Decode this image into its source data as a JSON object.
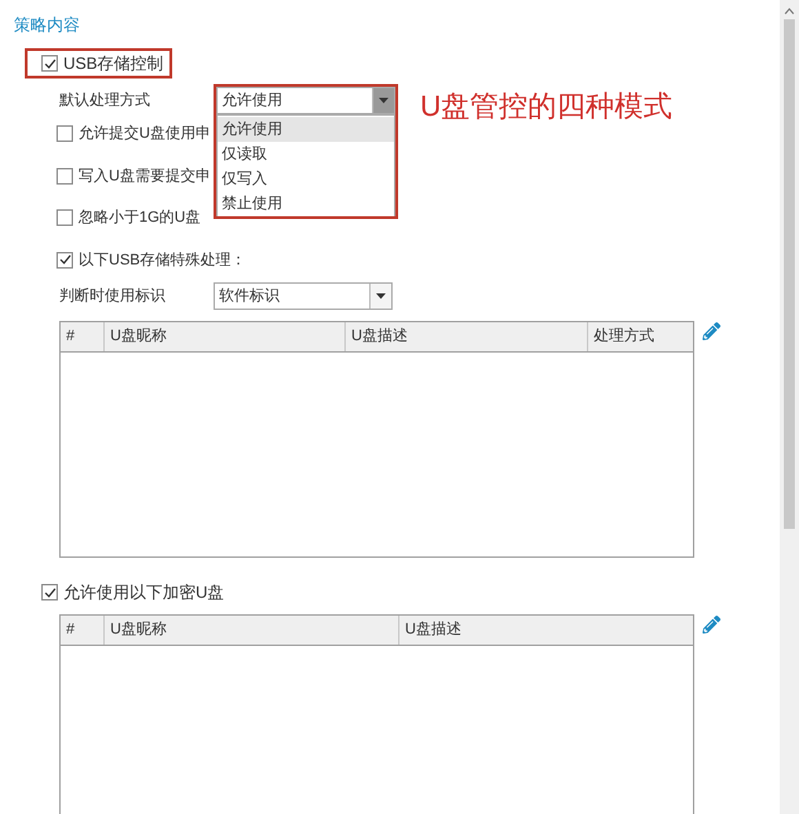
{
  "section_title": "策略内容",
  "usb_control": {
    "label": "USB存储控制",
    "checked": true
  },
  "default_action": {
    "label": "默认处理方式",
    "value": "允许使用",
    "expanded": true,
    "options": [
      {
        "label": "允许使用",
        "selected": true
      },
      {
        "label": "仅读取",
        "selected": false
      },
      {
        "label": "仅写入",
        "selected": false
      },
      {
        "label": "禁止使用",
        "selected": false
      }
    ]
  },
  "annotation": "U盘管控的四种模式",
  "options": [
    {
      "label": "允许提交U盘使用申",
      "checked": false
    },
    {
      "label": "写入U盘需要提交申",
      "checked": false
    },
    {
      "label": "忽略小于1G的U盘",
      "checked": false
    }
  ],
  "special_handling": {
    "label": "以下USB存储特殊处理：",
    "checked": true
  },
  "identifier": {
    "label": "判断时使用标识",
    "value": "软件标识"
  },
  "usb_table": {
    "columns": [
      "#",
      "U盘昵称",
      "U盘描述",
      "处理方式"
    ]
  },
  "encrypted": {
    "label": "允许使用以下加密U盘",
    "checked": true
  },
  "encrypted_table": {
    "columns": [
      "#",
      "U盘昵称",
      "U盘描述"
    ]
  }
}
